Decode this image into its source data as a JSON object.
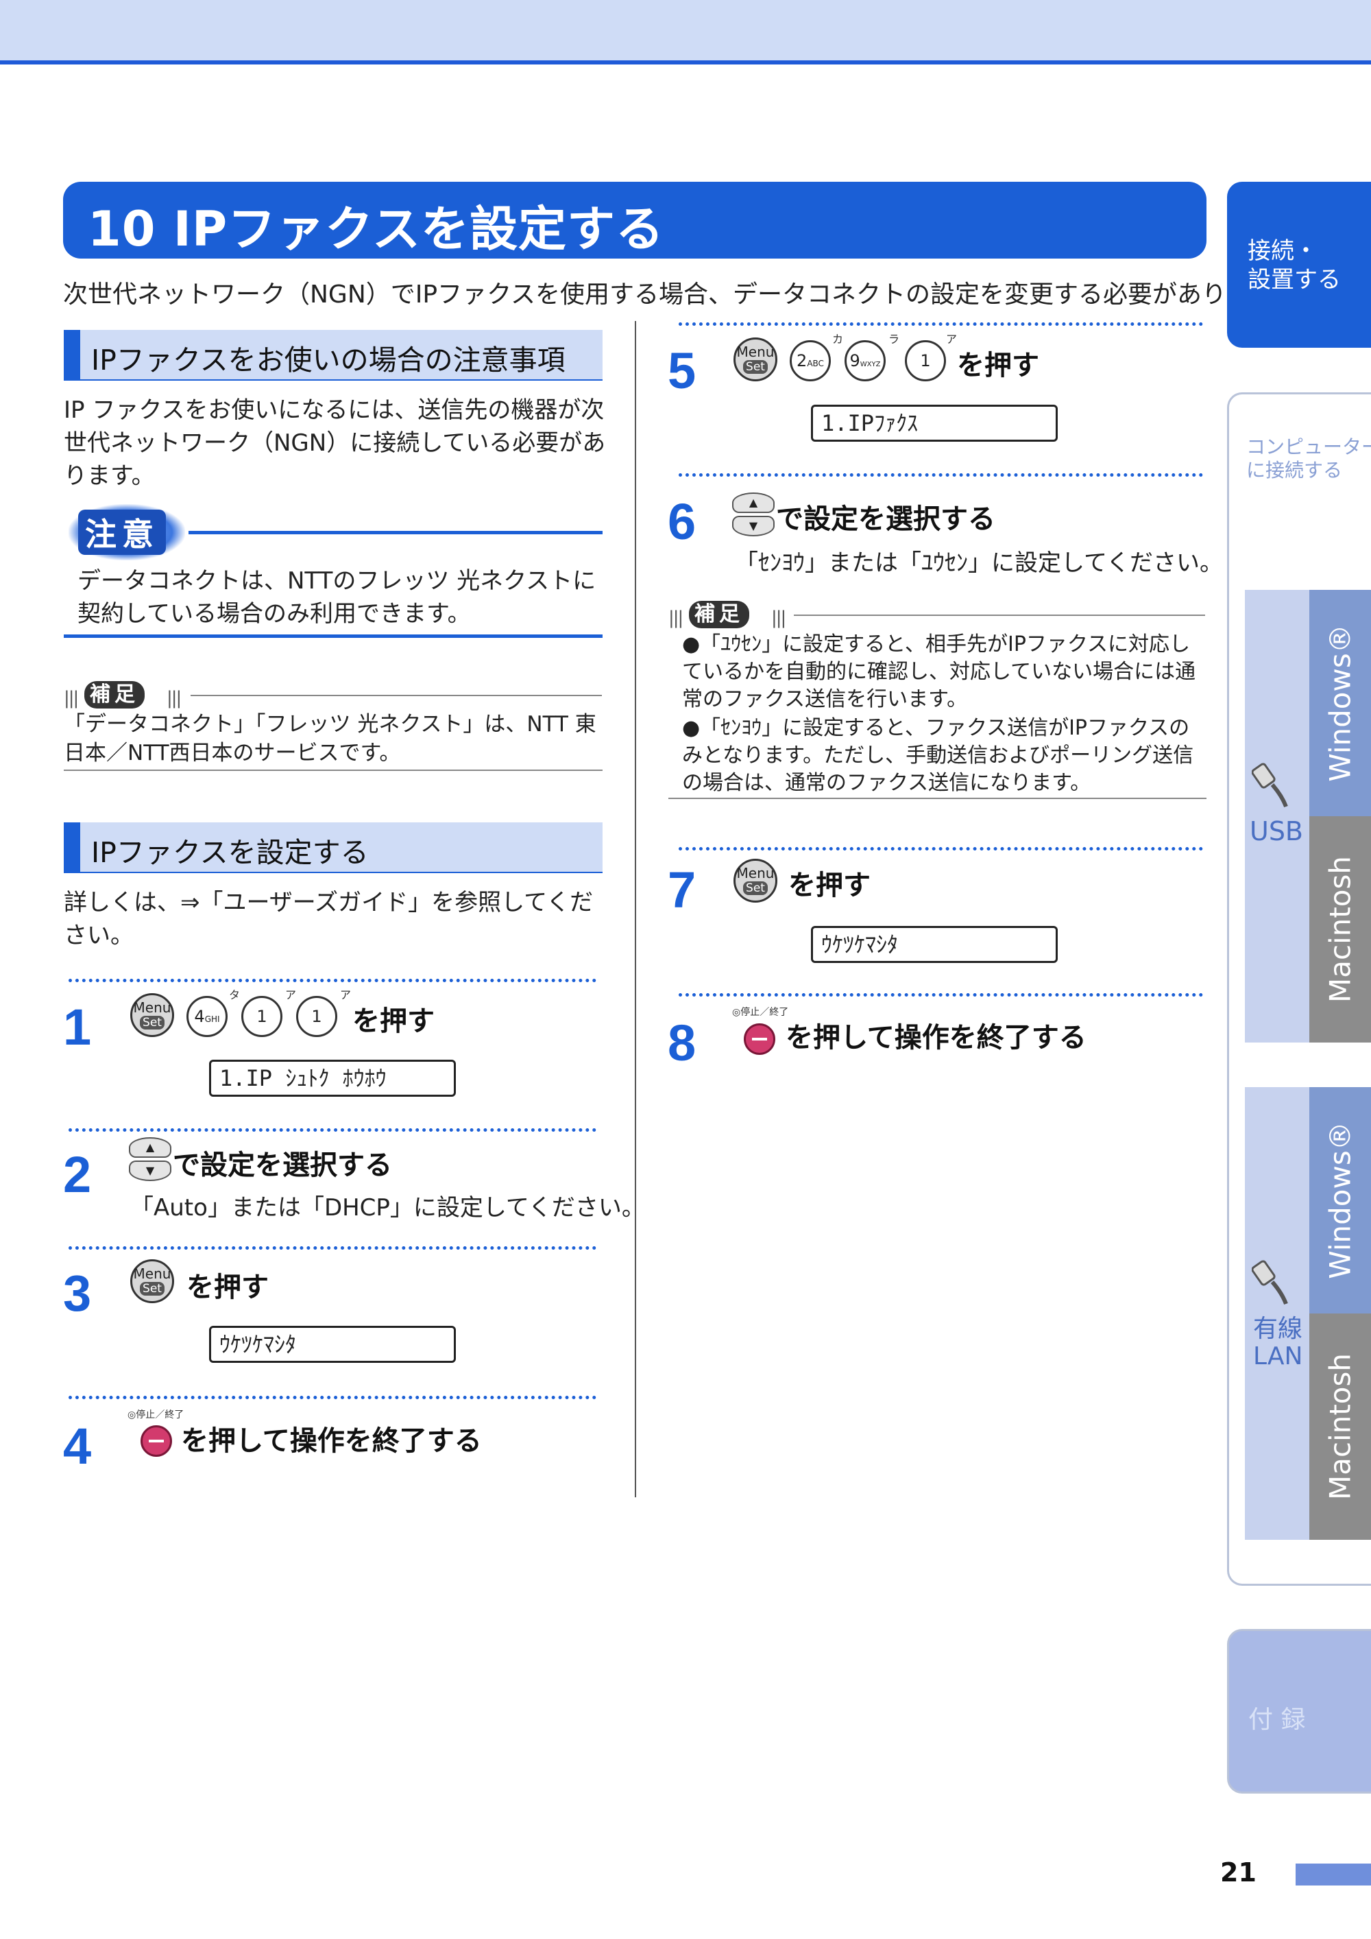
{
  "header": {
    "title": "10 IPファクスを設定する",
    "intro": "次世代ネットワーク（NGN）でIPファクスを使用する場合、データコネクトの設定を変更する必要があります。"
  },
  "left": {
    "sec1_heading": "IPファクスをお使いの場合の注意事項",
    "sec1_body": "IP ファクスをお使いになるには、送信先の機器が次世代ネットワーク（NGN）に接続している必要があります。",
    "caution_label": "注意",
    "caution_body": "データコネクトは、NTTのフレッツ 光ネクストに契約している場合のみ利用できます。",
    "supp_label": "補足",
    "supp_body": "「データコネクト」「フレッツ 光ネクスト」は、NTT 東日本／NTT西日本のサービスです。",
    "sec2_heading": "IPファクスを設定する",
    "sec2_body": "詳しくは、⇒「ユーザーズガイド」を参照してください。"
  },
  "steps": {
    "s1": {
      "num": "1",
      "text": "を押す",
      "lcd": "1.IP ｼｭﾄｸ ﾎｳﾎｳ"
    },
    "s2": {
      "num": "2",
      "text": "で設定を選択する",
      "sub": "「Auto」または「DHCP」に設定してください。"
    },
    "s3": {
      "num": "3",
      "text": "を押す",
      "lcd": "ｳｹﾂｹﾏｼﾀ"
    },
    "s4": {
      "num": "4",
      "text": "を押して操作を終了する"
    },
    "s5": {
      "num": "5",
      "text": "を押す",
      "lcd": "1.IPﾌｧｸｽ"
    },
    "s6": {
      "num": "6",
      "text": "で設定を選択する",
      "sub": "「ｾﾝﾖｳ」または「ﾕｳｾﾝ」に設定してください。"
    },
    "s7": {
      "num": "7",
      "text": "を押す",
      "lcd": "ｳｹﾂｹﾏｼﾀ"
    },
    "s8": {
      "num": "8",
      "text": "を押して操作を終了する"
    }
  },
  "right_supp": {
    "label": "補足",
    "item1": "●「ﾕｳｾﾝ」に設定すると、相手先がIPファクスに対応しているかを自動的に確認し、対応していない場合には通常のファクス送信を行います。",
    "item2": "●「ｾﾝﾖｳ」に設定すると、ファクス送信がIPファクスのみとなります。ただし、手動送信およびポーリング送信の場合は、通常のファクス送信になります。"
  },
  "keys": {
    "menu_top": "Menu",
    "menu_bottom": "Set",
    "k4": "4",
    "k4_sub": "GHI",
    "k1": "1",
    "k2": "2",
    "k2_sub": "ABC",
    "k9": "9",
    "k9_sub": "WXYZ",
    "kana_ta": "タ",
    "kana_a": "ア",
    "kana_ka": "カ",
    "kana_ra": "ラ",
    "stop_caption": "◎停止／終了"
  },
  "side_tabs": {
    "setup": "接続・\n設置する",
    "computer": "コンピューター\nに接続する",
    "usb": "USB",
    "windows": "Windows®",
    "macintosh": "Macintosh",
    "lan": "有線\nLAN",
    "appendix": "付 録"
  },
  "colors": {
    "accent": "#1b5fd6",
    "heading_bg": "#cfdcf6",
    "tab_windows": "#7f9ad0",
    "tab_mac": "#8c8c8c"
  },
  "page_number": "21"
}
